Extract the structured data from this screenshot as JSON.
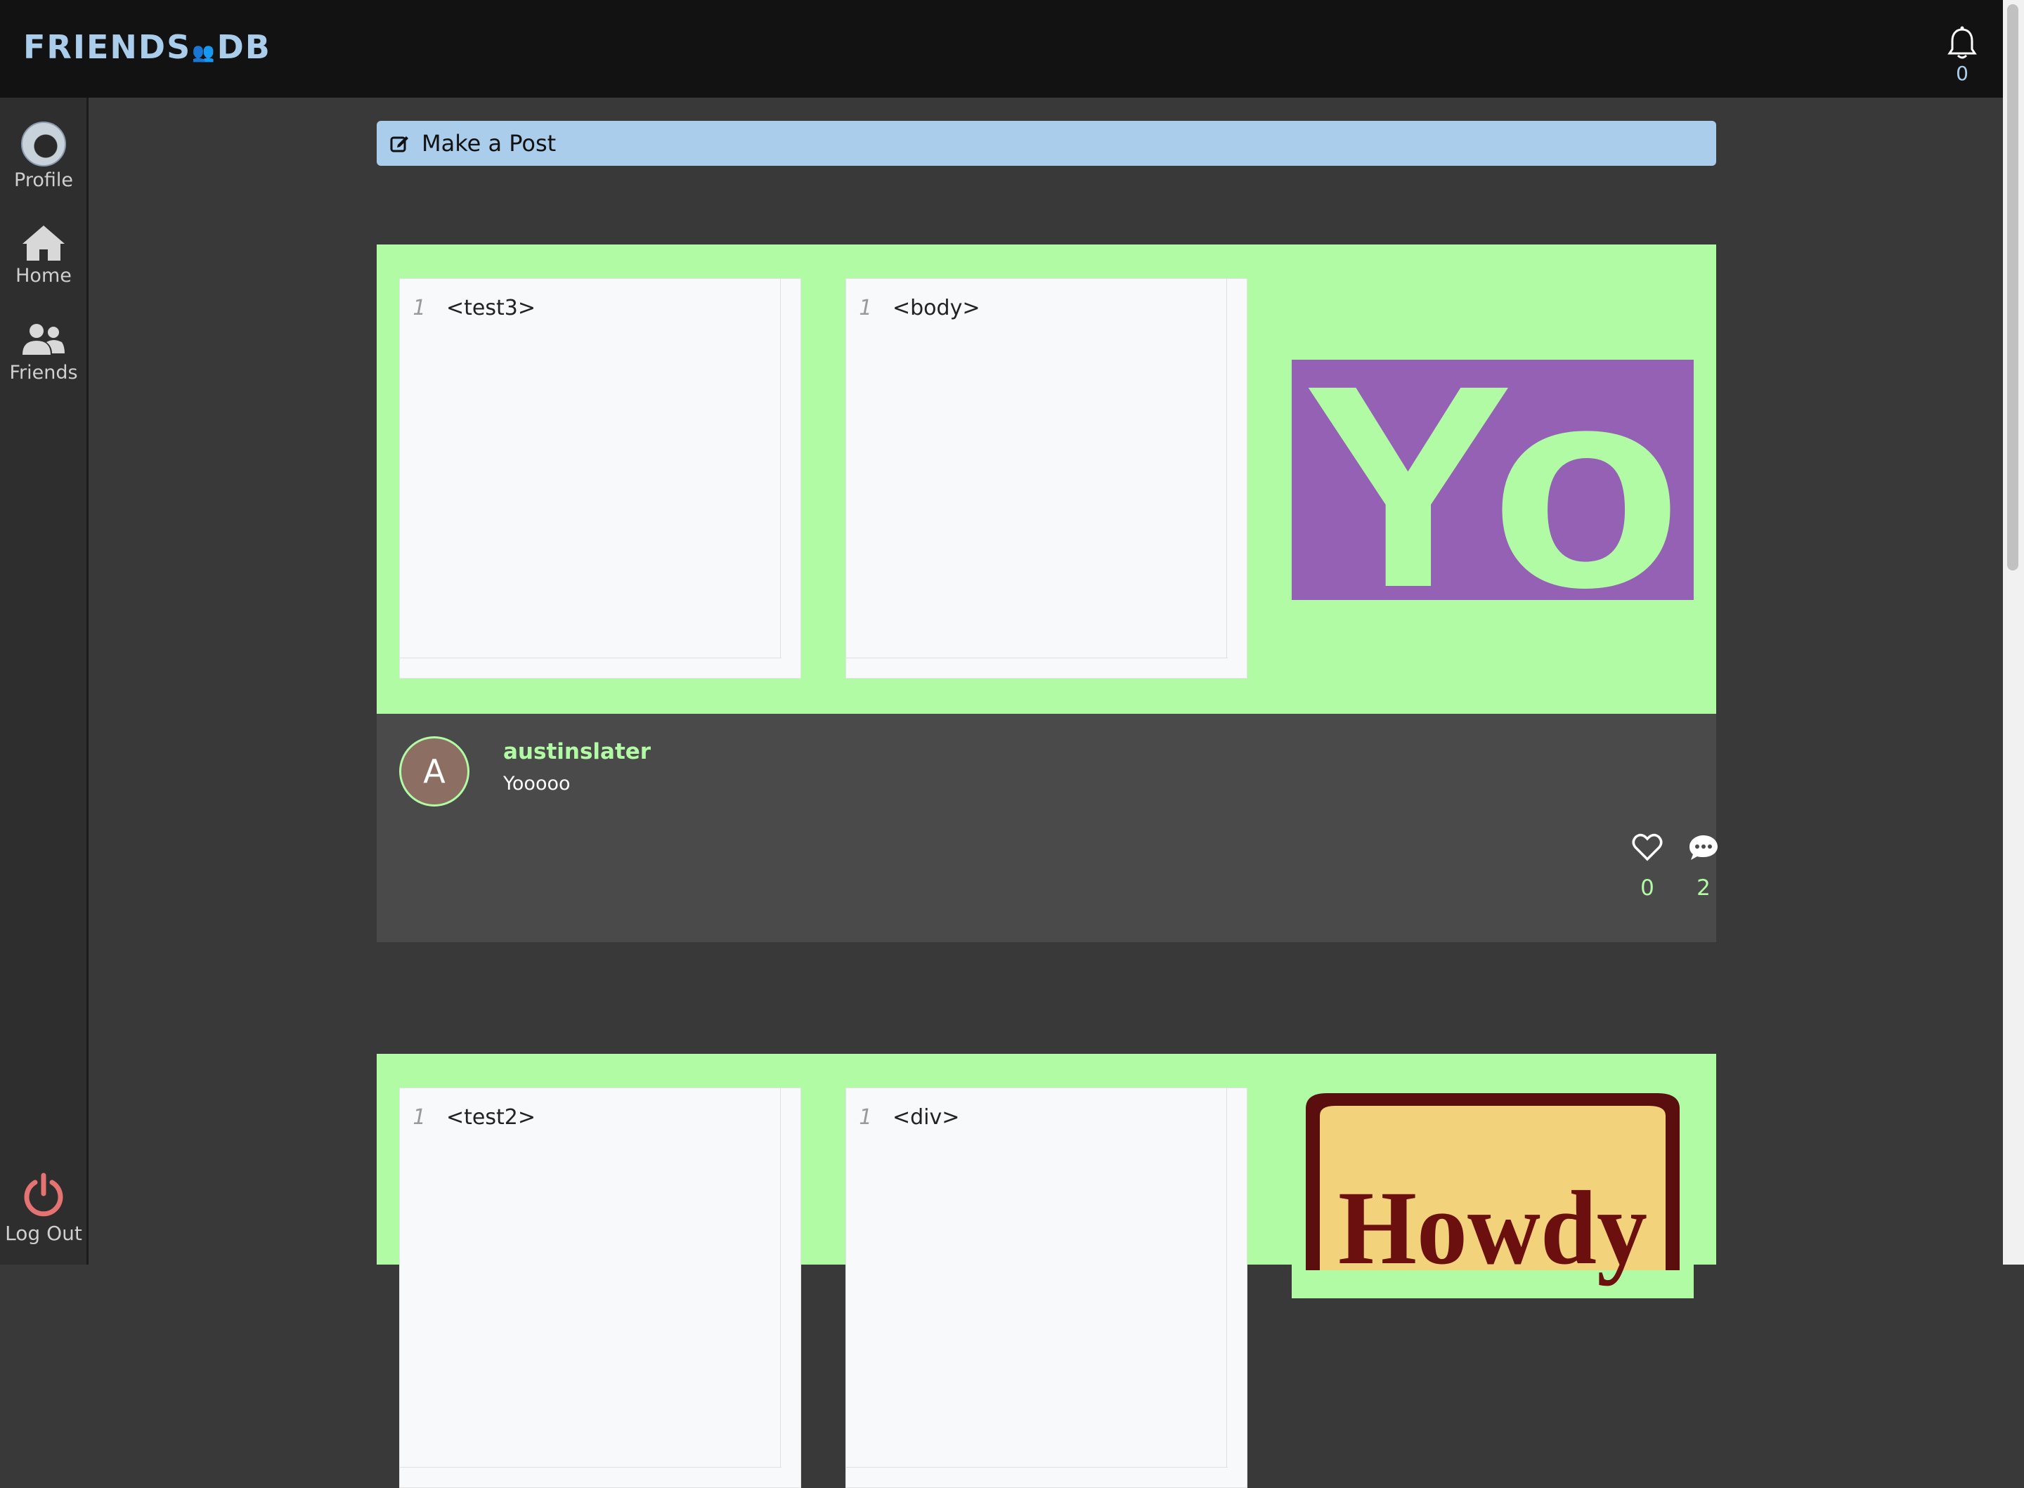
{
  "app": {
    "logo_left": "FRIENDS",
    "logo_right": "DB",
    "accent": "#a9cdeb",
    "post_bg": "#b2fba5"
  },
  "header": {
    "notification_count": "0"
  },
  "sidebar": {
    "items": [
      {
        "label": "Profile"
      },
      {
        "label": "Home"
      },
      {
        "label": "Friends"
      }
    ],
    "logout_label": "Log Out"
  },
  "composer": {
    "label": "Make a Post"
  },
  "posts": [
    {
      "html_code": "<test3>",
      "css_code": "<body>",
      "line_no": "1",
      "preview_text": "Yo",
      "author_initial": "A",
      "author": "austinslater",
      "caption": "Yooooo",
      "likes": "0",
      "comments": "2"
    },
    {
      "html_code": "<test2>",
      "css_code": "<div>",
      "line_no": "1",
      "preview_text": "Howdy"
    }
  ]
}
